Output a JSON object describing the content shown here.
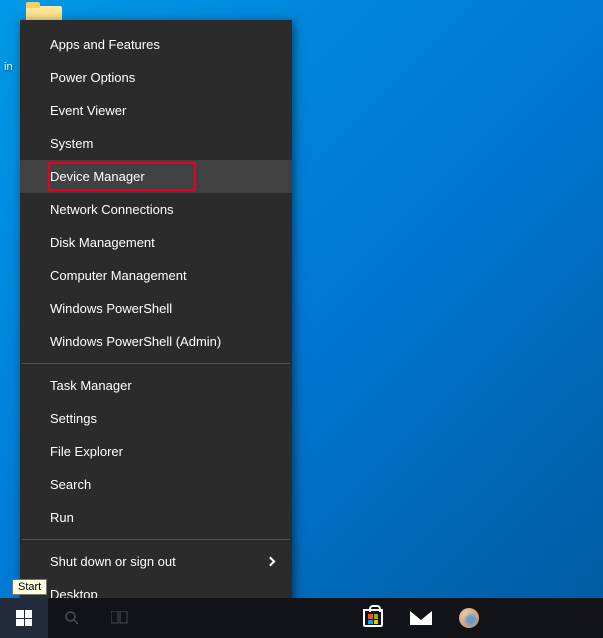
{
  "desktop": {
    "icon_name": "folder-icon",
    "label_fragment": "in"
  },
  "tooltip": {
    "text": "Start"
  },
  "context_menu": {
    "group1": [
      {
        "label": "Apps and Features"
      },
      {
        "label": "Power Options"
      },
      {
        "label": "Event Viewer"
      },
      {
        "label": "System"
      },
      {
        "label": "Device Manager",
        "hover": true,
        "highlighted": true
      },
      {
        "label": "Network Connections"
      },
      {
        "label": "Disk Management"
      },
      {
        "label": "Computer Management"
      },
      {
        "label": "Windows PowerShell"
      },
      {
        "label": "Windows PowerShell (Admin)"
      }
    ],
    "group2": [
      {
        "label": "Task Manager"
      },
      {
        "label": "Settings"
      },
      {
        "label": "File Explorer"
      },
      {
        "label": "Search"
      },
      {
        "label": "Run"
      }
    ],
    "group3": [
      {
        "label": "Shut down or sign out",
        "submenu": true
      },
      {
        "label": "Desktop"
      }
    ]
  },
  "taskbar": {
    "start": "start-button",
    "items_left": [
      "search-icon",
      "task-view-icon"
    ],
    "items_right": [
      "store-icon",
      "mail-icon",
      "people-icon"
    ]
  }
}
